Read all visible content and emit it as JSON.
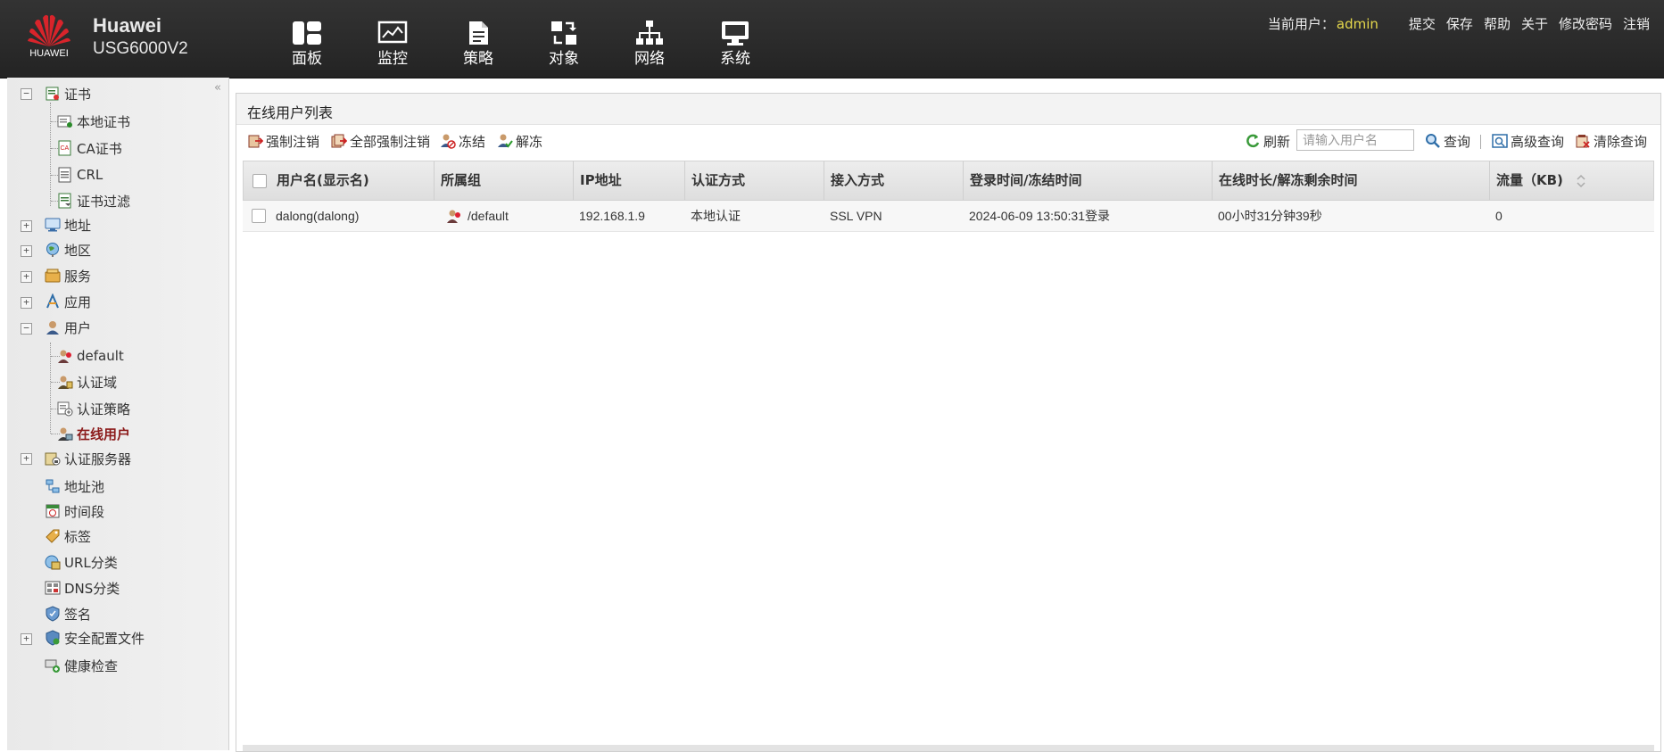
{
  "header": {
    "brand": "HUAWEI",
    "product_line1": "Huawei",
    "product_line2": "USG6000V2",
    "nav": [
      {
        "label": "面板",
        "icon": "dashboard-icon"
      },
      {
        "label": "监控",
        "icon": "monitor-icon"
      },
      {
        "label": "策略",
        "icon": "policy-icon"
      },
      {
        "label": "对象",
        "icon": "object-icon"
      },
      {
        "label": "网络",
        "icon": "network-icon"
      },
      {
        "label": "系统",
        "icon": "system-icon"
      }
    ],
    "current_user_label": "当前用户：",
    "current_user": "admin",
    "links": [
      "提交",
      "保存",
      "帮助",
      "关于",
      "修改密码",
      "注销"
    ]
  },
  "sidebar": {
    "items": [
      {
        "label": "证书",
        "icon": "certificate-icon",
        "expander": "−"
      },
      {
        "label": "本地证书",
        "icon": "local-cert-icon"
      },
      {
        "label": "CA证书",
        "icon": "ca-cert-icon"
      },
      {
        "label": "CRL",
        "icon": "crl-icon"
      },
      {
        "label": "证书过滤",
        "icon": "cert-filter-icon"
      },
      {
        "label": "地址",
        "icon": "address-icon",
        "expander": "+"
      },
      {
        "label": "地区",
        "icon": "region-icon",
        "expander": "+"
      },
      {
        "label": "服务",
        "icon": "service-icon",
        "expander": "+"
      },
      {
        "label": "应用",
        "icon": "application-icon",
        "expander": "+"
      },
      {
        "label": "用户",
        "icon": "user-icon",
        "expander": "−"
      },
      {
        "label": "default",
        "icon": "user-group-icon"
      },
      {
        "label": "认证域",
        "icon": "auth-domain-icon"
      },
      {
        "label": "认证策略",
        "icon": "auth-policy-icon"
      },
      {
        "label": "在线用户",
        "icon": "online-user-icon",
        "active": true
      },
      {
        "label": "认证服务器",
        "icon": "auth-server-icon",
        "expander": "+"
      },
      {
        "label": "地址池",
        "icon": "address-pool-icon"
      },
      {
        "label": "时间段",
        "icon": "time-range-icon"
      },
      {
        "label": "标签",
        "icon": "tag-icon"
      },
      {
        "label": "URL分类",
        "icon": "url-category-icon"
      },
      {
        "label": "DNS分类",
        "icon": "dns-category-icon"
      },
      {
        "label": "签名",
        "icon": "signature-icon"
      },
      {
        "label": "安全配置文件",
        "icon": "security-profile-icon",
        "expander": "+"
      },
      {
        "label": "健康检查",
        "icon": "health-check-icon"
      }
    ]
  },
  "main": {
    "title": "在线用户列表",
    "toolbar": {
      "force_logout": "强制注销",
      "force_logout_all": "全部强制注销",
      "freeze": "冻结",
      "unfreeze": "解冻",
      "refresh": "刷新",
      "search_placeholder": "请输入用户名",
      "query": "查询",
      "advanced_query": "高级查询",
      "clear_query": "清除查询"
    },
    "columns": [
      "用户名(显示名)",
      "所属组",
      "IP地址",
      "认证方式",
      "接入方式",
      "登录时间/冻结时间",
      "在线时长/解冻剩余时间",
      "流量（KB)"
    ],
    "rows": [
      {
        "username": "dalong(dalong)",
        "group": "/default",
        "ip": "192.168.1.9",
        "auth_method": "本地认证",
        "access_method": "SSL VPN",
        "login_time": "2024-06-09 13:50:31登录",
        "online_duration": "00小时31分钟39秒",
        "traffic": "0"
      }
    ]
  }
}
